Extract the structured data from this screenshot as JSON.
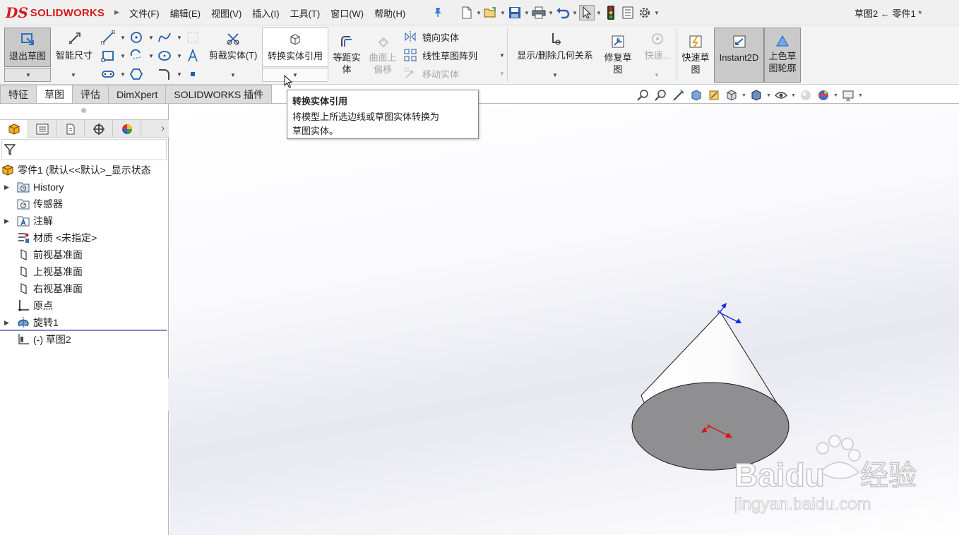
{
  "app": {
    "brand": "SOLIDWORKS",
    "brand_ds": "DS",
    "menus": [
      "文件(F)",
      "编辑(E)",
      "视图(V)",
      "插入(I)",
      "工具(T)",
      "窗口(W)",
      "帮助(H)"
    ],
    "doc_title": "草图2 ← 零件1 *"
  },
  "ribbon": {
    "exit_sketch": "退出草图",
    "smart_dimension": "智能尺寸",
    "trim_entities": "剪裁实体(T)",
    "convert_entities": "转换实体引用",
    "offset_entities_line1": "等距实",
    "offset_entities_line2": "体",
    "offset_on_surface_line1": "曲面上",
    "offset_on_surface_line2": "偏移",
    "mirror_entities": "镜向实体",
    "linear_pattern": "线性草图阵列",
    "move_entities": "移动实体",
    "display_relations": "显示/删除几何关系",
    "repair_sketch_line1": "修复草",
    "repair_sketch_line2": "图",
    "quick_snaps": "快速...",
    "rapid_sketch_line1": "快速草",
    "rapid_sketch_line2": "图",
    "instant2d": "Instant2D",
    "shaded_sketch_line1": "上色草",
    "shaded_sketch_line2": "图轮廓"
  },
  "tabs": [
    "特征",
    "草图",
    "评估",
    "DimXpert",
    "SOLIDWORKS 插件"
  ],
  "active_tab": "草图",
  "tooltip": {
    "title": "转换实体引用",
    "body_line1": "将模型上所选边线或草图实体转换为",
    "body_line2": "草图实体。"
  },
  "tree": {
    "root": "零件1 (默认<<默认>_显示状态",
    "items": [
      {
        "label": "History",
        "icon": "history-folder-icon",
        "expandable": true
      },
      {
        "label": "传感器",
        "icon": "sensor-icon",
        "expandable": false
      },
      {
        "label": "注解",
        "icon": "annotations-icon",
        "expandable": true
      },
      {
        "label": "材质 <未指定>",
        "icon": "material-icon",
        "expandable": false
      },
      {
        "label": "前视基准面",
        "icon": "plane-icon",
        "expandable": false
      },
      {
        "label": "上视基准面",
        "icon": "plane-icon",
        "expandable": false
      },
      {
        "label": "右视基准面",
        "icon": "plane-icon",
        "expandable": false
      },
      {
        "label": "原点",
        "icon": "origin-icon",
        "expandable": false
      },
      {
        "label": "旋转1",
        "icon": "revolve-icon",
        "expandable": true
      },
      {
        "label": "(-) 草图2",
        "icon": "sketch-icon",
        "expandable": false
      }
    ]
  },
  "watermark": {
    "brand": "Baidu",
    "jingyan": "经验",
    "url": "jingyan.baidu.com"
  },
  "colors": {
    "brand_red": "#d51b1b",
    "cone_base": "#8f8e91",
    "origin_red": "#e01010",
    "axis_blue": "#1030e0",
    "rollback_bar": "#8b86c6"
  }
}
